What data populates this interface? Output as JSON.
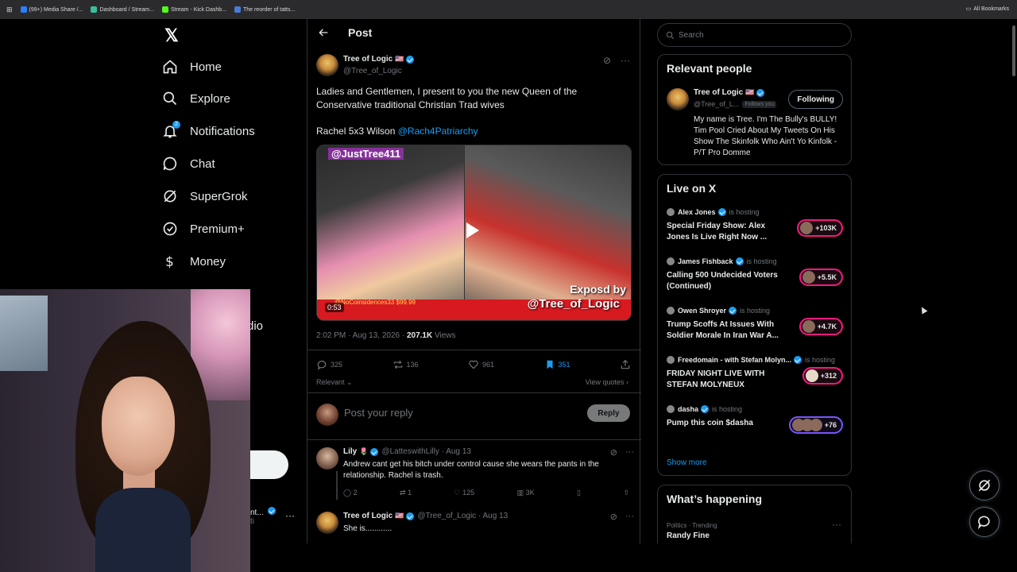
{
  "bookmarks": [
    "(99+) Media Share /...",
    "Dashboard / Stream...",
    "Stream - Kick Dashb...",
    "The reorder of tatts..."
  ],
  "all_bookmarks": "All Bookmarks",
  "nav": {
    "items": [
      "Home",
      "Explore",
      "Notifications",
      "Chat",
      "SuperGrok",
      "Premium+",
      "Money"
    ],
    "partial_item": "dio",
    "notif_badge": "2",
    "account_partial": "nt...",
    "account_handle_partial": "ti"
  },
  "header": {
    "title": "Post"
  },
  "post": {
    "name": "Tree of Logic",
    "flag": "🇺🇸",
    "handle": "@Tree_of_Logic",
    "text_line1": "Ladies and Gentlemen, I present to you the new Queen of the Conservative traditional Christian Trad wives",
    "text_line2_prefix": "Rachel 5x3 Wilson",
    "mention": "@Rach4Patriarchy",
    "video": {
      "watermark": "@JustTree411",
      "exposed": "Exposd by",
      "handle_tag": "@Tree_of_Logic",
      "duration": "0:53",
      "coin": "@NoCoinsidences33 $99.99"
    },
    "timestamp": "2:02 PM · Aug 13, 2026 ·",
    "views_count": "207.1K",
    "views_label": "Views",
    "replies": "325",
    "reposts": "136",
    "likes": "961",
    "bookmarks": "351",
    "relevant": "Relevant",
    "view_quotes": "View quotes"
  },
  "reply_box": {
    "placeholder": "Post your reply",
    "button": "Reply"
  },
  "replies": [
    {
      "name": "Lily",
      "emoji": "🌷",
      "handle": "@LatteswithLilly · Aug 13",
      "text": "Andrew cant get his bitch under control cause she wears the pants in the relationship. Rachel is trash.",
      "replies": "2",
      "reposts": "1",
      "likes": "125",
      "views": "3K"
    },
    {
      "name": "Tree of Logic",
      "emoji": "🇺🇸",
      "handle": "@Tree_of_Logic · Aug 13",
      "text": "She is............"
    }
  ],
  "search": {
    "placeholder": "Search"
  },
  "relevant_people": {
    "title": "Relevant people",
    "name": "Tree of Logic",
    "flag": "🇺🇸",
    "handle": "@Tree_of_L...",
    "follows_you": "Follows you",
    "button": "Following",
    "bio": "My name is Tree. I'm The Bully's BULLY! Tim Pool Cried About My Tweets On His Show The Skinfolk Who Ain't Yo Kinfolk - P/T Pro Domme"
  },
  "live": {
    "title": "Live on X",
    "hosting_label": "is hosting",
    "items": [
      {
        "host": "Alex Jones",
        "title": "Special Friday Show: Alex Jones Is Live Right Now ...",
        "count": "+103K"
      },
      {
        "host": "James Fishback",
        "title": "Calling 500 Undecided Voters (Continued)",
        "count": "+5.5K"
      },
      {
        "host": "Owen Shroyer",
        "title": "Trump Scoffs At Issues With Soldier Morale In Iran War A...",
        "count": "+4.7K"
      },
      {
        "host": "Freedomain - with Stefan Molyn...",
        "title": "FRIDAY NIGHT LIVE WITH STEFAN MOLYNEUX",
        "count": "+312"
      },
      {
        "host": "dasha",
        "title": "Pump this coin $dasha",
        "count": "+76"
      }
    ],
    "show_more": "Show more"
  },
  "happening": {
    "title": "What’s happening",
    "category": "Politics · Trending",
    "trend": "Randy Fine"
  },
  "colors": {
    "accent": "#1d9bf0",
    "live_ring": "#f91880",
    "bg": "#000000"
  }
}
